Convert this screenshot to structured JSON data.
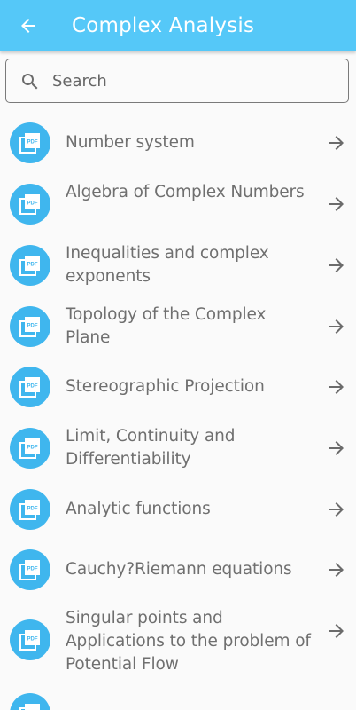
{
  "appbar": {
    "title": "Complex Analysis",
    "back_icon": "arrow-left-icon",
    "background": "#55c8f8"
  },
  "search": {
    "placeholder": "Search",
    "value": "",
    "icon": "search-icon"
  },
  "list": {
    "item_icon": "pdf-file-icon",
    "item_icon_color": "#3fb6ee",
    "trailing_icon": "arrow-right-icon",
    "pdf_badge_text": "PDF",
    "items": [
      {
        "label": "Number system"
      },
      {
        "label": "Algebra of Complex Numbers"
      },
      {
        "label": "Inequalities and complex exponents"
      },
      {
        "label": "Topology of the Complex Plane"
      },
      {
        "label": "Stereographic Projection"
      },
      {
        "label": "Limit, Continuity and Differentiability"
      },
      {
        "label": "Analytic functions"
      },
      {
        "label": "Cauchy?Riemann equations"
      },
      {
        "label": "Singular points and Applications to the problem of Potential Flow"
      },
      {
        "label": ""
      }
    ]
  }
}
